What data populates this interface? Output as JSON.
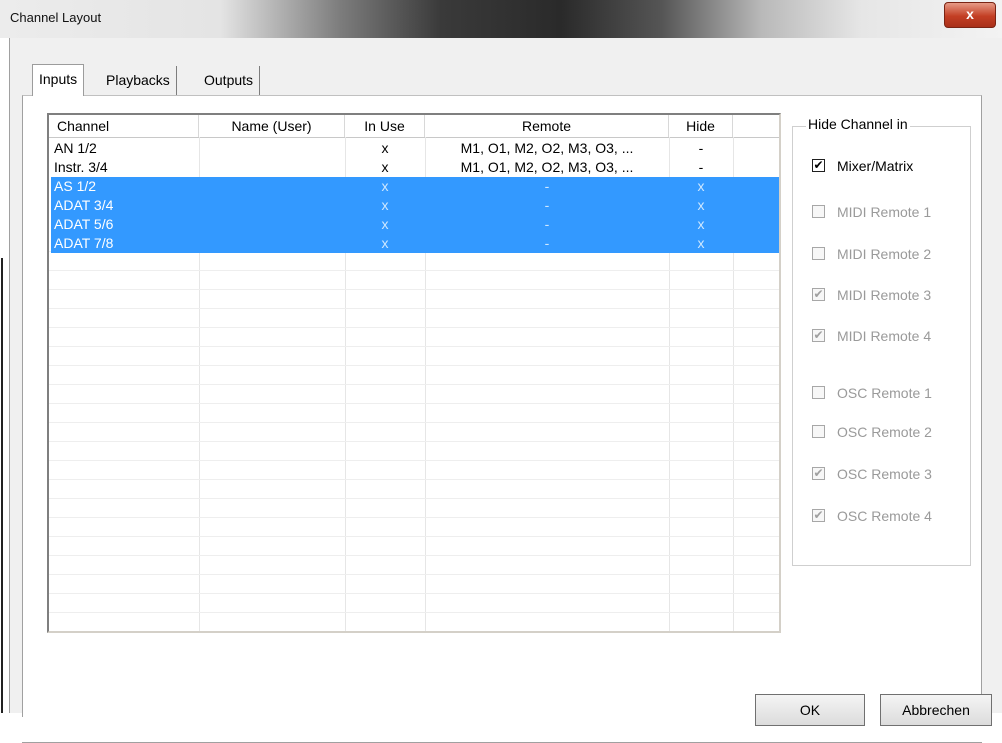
{
  "window": {
    "title": "Channel Layout",
    "close_glyph": "x"
  },
  "tabs": [
    {
      "label": "Inputs",
      "active": true
    },
    {
      "label": "Playbacks",
      "active": false
    },
    {
      "label": "Outputs",
      "active": false
    }
  ],
  "table": {
    "columns": [
      "Channel",
      "Name (User)",
      "In Use",
      "Remote",
      "Hide"
    ],
    "rows": [
      {
        "channel": "AN 1/2",
        "name": "",
        "in_use": "x",
        "remote": "M1, O1, M2, O2, M3, O3, ...",
        "hide": "-",
        "selected": false
      },
      {
        "channel": "Instr. 3/4",
        "name": "",
        "in_use": "x",
        "remote": "M1, O1, M2, O2, M3, O3, ...",
        "hide": "-",
        "selected": false
      },
      {
        "channel": "AS 1/2",
        "name": "",
        "in_use": "x",
        "remote": "-",
        "hide": "x",
        "selected": true
      },
      {
        "channel": "ADAT 3/4",
        "name": "",
        "in_use": "x",
        "remote": "-",
        "hide": "x",
        "selected": true
      },
      {
        "channel": "ADAT 5/6",
        "name": "",
        "in_use": "x",
        "remote": "-",
        "hide": "x",
        "selected": true
      },
      {
        "channel": "ADAT 7/8",
        "name": "",
        "in_use": "x",
        "remote": "-",
        "hide": "x",
        "selected": true
      }
    ]
  },
  "hide_group": {
    "title": "Hide Channel in",
    "options": [
      {
        "label": "Mixer/Matrix",
        "checked": true,
        "enabled": true,
        "mark": "✔"
      },
      {
        "label": "MIDI Remote 1",
        "checked": false,
        "enabled": false,
        "mark": ""
      },
      {
        "label": "MIDI Remote 2",
        "checked": false,
        "enabled": false,
        "mark": ""
      },
      {
        "label": "MIDI Remote 3",
        "checked": true,
        "enabled": false,
        "mark": "✔"
      },
      {
        "label": "MIDI Remote 4",
        "checked": true,
        "enabled": false,
        "mark": "✔"
      },
      {
        "label": "OSC Remote 1",
        "checked": false,
        "enabled": false,
        "mark": ""
      },
      {
        "label": "OSC Remote 2",
        "checked": false,
        "enabled": false,
        "mark": ""
      },
      {
        "label": "OSC Remote 3",
        "checked": true,
        "enabled": false,
        "mark": "✔"
      },
      {
        "label": "OSC Remote 4",
        "checked": true,
        "enabled": false,
        "mark": "✔"
      }
    ]
  },
  "buttons": {
    "ok": "OK",
    "cancel": "Abbrechen"
  },
  "colors": {
    "selection": "#3399ff",
    "close_button": "#c33f24"
  }
}
